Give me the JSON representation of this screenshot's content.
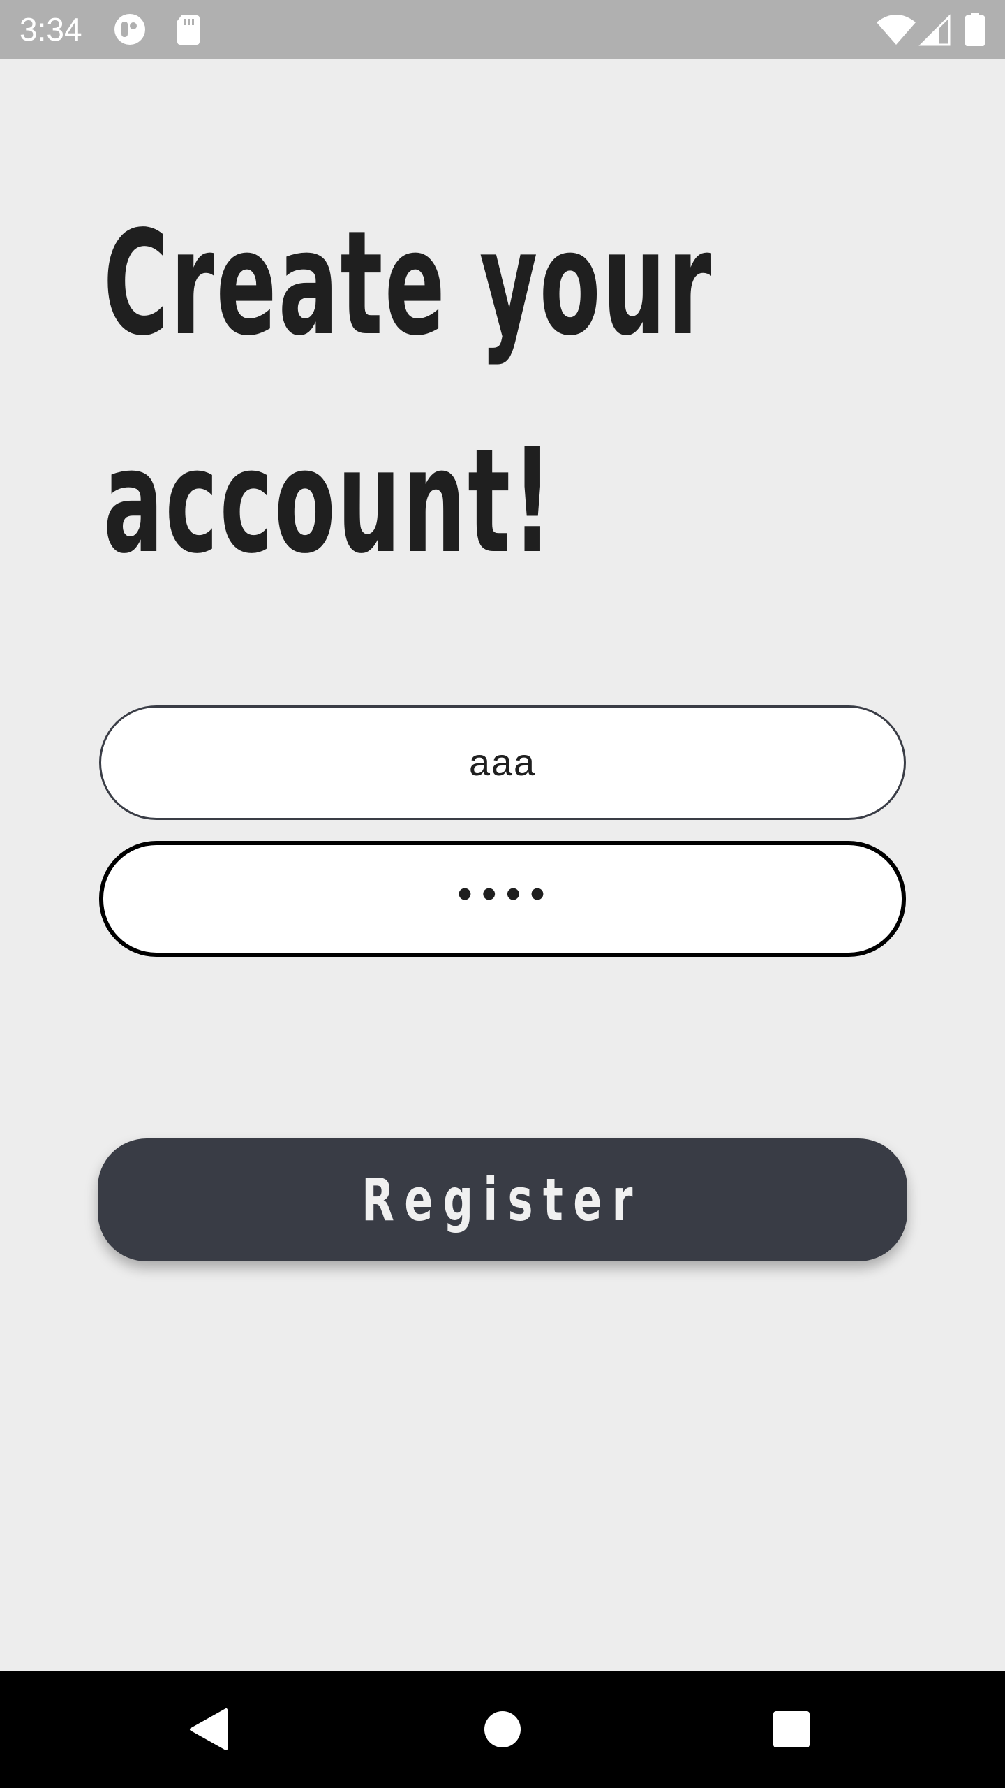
{
  "status_bar": {
    "time": "3:34",
    "icons": [
      "app-notification-icon",
      "sd-card-icon",
      "wifi-icon",
      "signal-icon",
      "battery-icon"
    ]
  },
  "headline": {
    "line1": "Create your",
    "line2": "account!"
  },
  "form": {
    "username_value": "aaa",
    "password_masked": "••••"
  },
  "register_button": {
    "label": "Register"
  },
  "nav_bar": {
    "buttons": [
      "back-icon",
      "home-icon",
      "recents-icon"
    ]
  },
  "colors": {
    "background": "#EDEDED",
    "status_bar": "#B0B0B0",
    "button": "#393C45",
    "text": "#1F1F1F"
  }
}
